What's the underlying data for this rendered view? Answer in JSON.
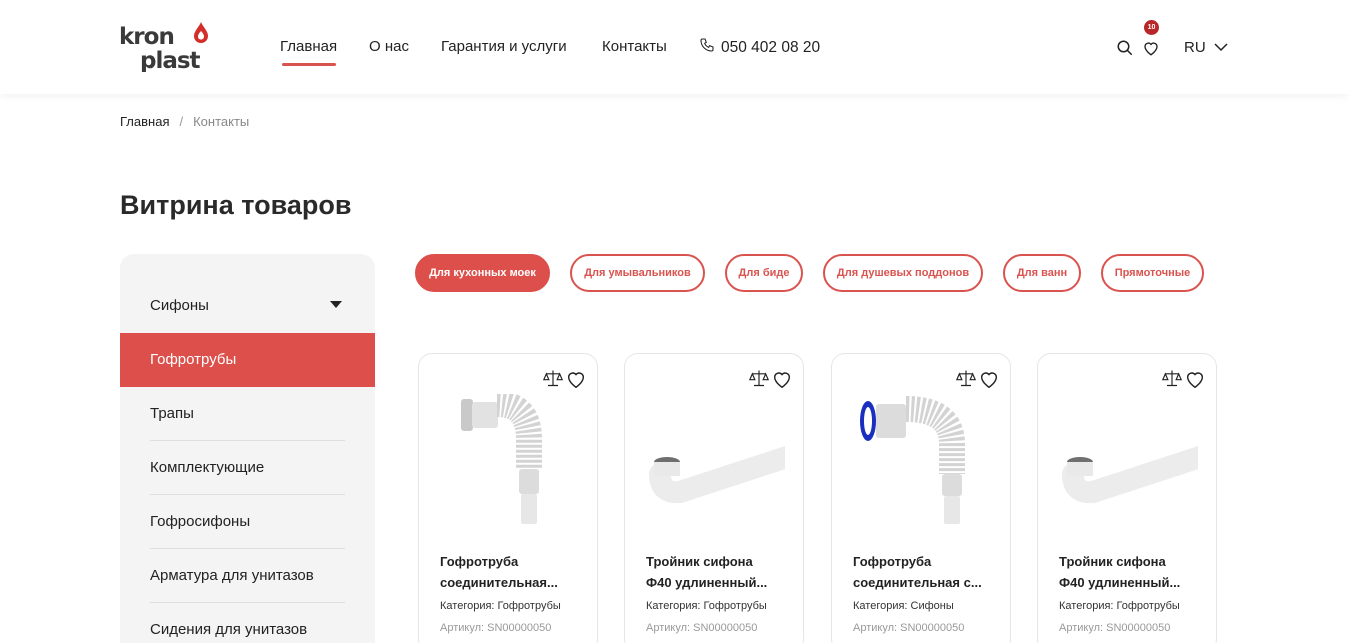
{
  "header": {
    "logo_top": "kron",
    "logo_bottom": "plast",
    "nav": [
      "Главная",
      "О нас",
      "Гарантия и услуги",
      "Контакты"
    ],
    "phone": "050 402 08 20",
    "favorites_count": "10",
    "language": "RU"
  },
  "breadcrumb": {
    "home": "Главная",
    "separator": "/",
    "current": "Контакты"
  },
  "page_title": "Витрина товаров",
  "sidebar": {
    "items": [
      {
        "label": "Сифоны"
      },
      {
        "label": "Гофротрубы"
      },
      {
        "label": "Трапы"
      },
      {
        "label": "Комплектующие"
      },
      {
        "label": "Гофросифоны"
      },
      {
        "label": "Арматура для унитазов"
      },
      {
        "label": "Сидения для унитазов"
      }
    ]
  },
  "filters": [
    "Для кухонных моек",
    "Для умывальников",
    "Для биде",
    "Для душевых поддонов",
    "Для ванн",
    "Прямоточные"
  ],
  "products": [
    {
      "name_line1": "Гофротруба",
      "name_line2": "соединительная...",
      "category": "Категория: Гофротрубы",
      "sku": "Артикул: SN00000050"
    },
    {
      "name_line1": "Тройник сифона",
      "name_line2": "Ф40 удлиненный...",
      "category": "Категория: Гофротрубы",
      "sku": "Артикул: SN00000050"
    },
    {
      "name_line1": "Гофротруба",
      "name_line2": "соединительная с...",
      "category": "Категория: Сифоны",
      "sku": "Артикул: SN00000050"
    },
    {
      "name_line1": "Тройник сифона",
      "name_line2": "Ф40 удлиненный...",
      "category": "Категория: Гофротрубы",
      "sku": "Артикул: SN00000050"
    }
  ],
  "colors": {
    "accent": "#dc4f4a",
    "badge": "#b8262a",
    "sidebar_bg": "#f4f4f4"
  }
}
